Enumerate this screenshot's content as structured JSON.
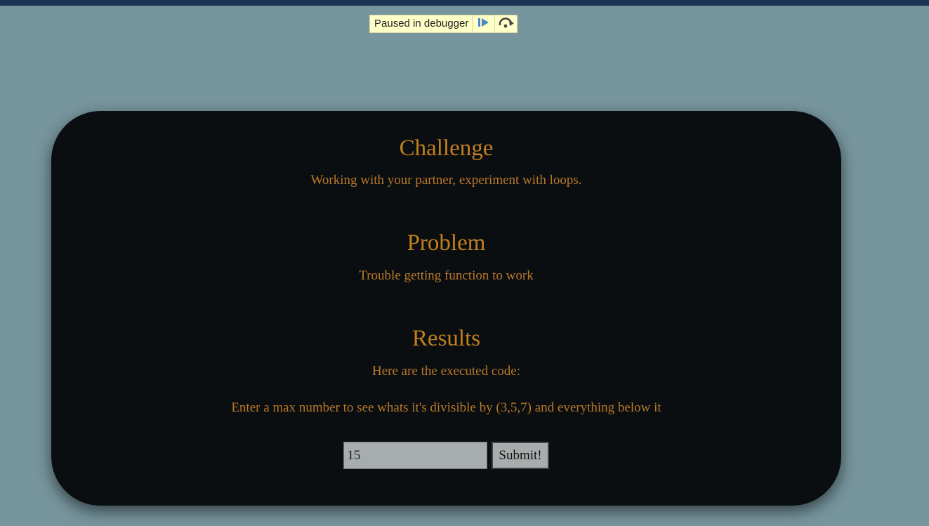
{
  "debugger": {
    "label": "Paused in debugger",
    "resume_icon": "resume-icon",
    "step_over_icon": "step-over-icon"
  },
  "colors": {
    "page_bg": "#77959e",
    "card_bg": "#0a0e10",
    "accent": "#c37f1e",
    "debug_bg": "#ffffc8"
  },
  "sections": {
    "challenge": {
      "title": "Challenge",
      "text": "Working with your partner, experiment with loops."
    },
    "problem": {
      "title": "Problem",
      "text": "Trouble getting function to work"
    },
    "results": {
      "title": "Results",
      "text": "Here are the executed code:",
      "prompt": "Enter a max number to see whats it's divisible by (3,5,7) and everything below it"
    }
  },
  "form": {
    "input_value": "15",
    "submit_label": "Submit!"
  }
}
